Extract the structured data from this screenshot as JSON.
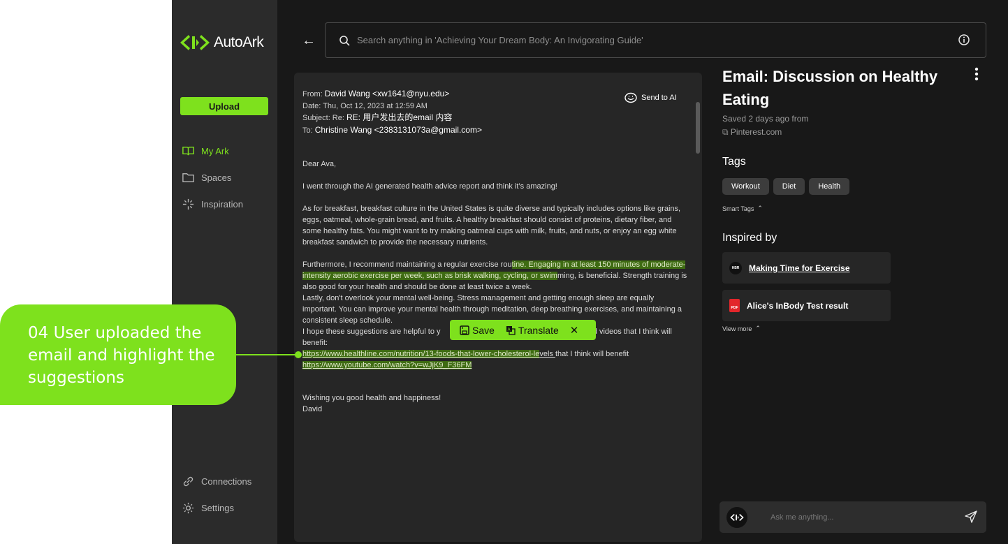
{
  "brand": {
    "name": "AutoArk",
    "accent": "#7ee11d"
  },
  "sidebar": {
    "upload_label": "Upload",
    "nav": [
      {
        "label": "My Ark",
        "icon": "book-icon",
        "active": true
      },
      {
        "label": "Spaces",
        "icon": "folder-icon",
        "active": false
      },
      {
        "label": "Inspiration",
        "icon": "sparkle-icon",
        "active": false
      }
    ],
    "bottom_nav": [
      {
        "label": "Connections",
        "icon": "link-icon"
      },
      {
        "label": "Settings",
        "icon": "gear-icon"
      }
    ]
  },
  "search": {
    "placeholder": "Search anything in 'Achieving Your Dream Body: An Invigorating Guide'"
  },
  "email": {
    "from_label": "From:",
    "from_value": "David Wang <xw1641@nyu.edu>",
    "date_line": "Date: Thu, Oct 12, 2023 at 12:59 AM",
    "subject_label": "Subject: Re:",
    "subject_value": "RE: 用户发出去的email 内容",
    "to_label": "To:",
    "to_value": "Christine Wang <2383131073a@gmail.com>",
    "send_to_ai": "Send to AI",
    "greeting": "Dear Ava,",
    "p1": " I went through the AI generated health advice report and think it’s amazing!",
    "p2": "As for breakfast, breakfast culture in the United States is quite diverse and typically includes options like grains, eggs, oatmeal, whole-grain bread, and fruits. A healthy breakfast should consist of proteins, dietary fiber, and some healthy fats. You might want to try making oatmeal cups with milk, fruits, and nuts, or enjoy an egg white breakfast sandwich to provide the necessary nutrients.",
    "p3_a": "Furthermore, I recommend maintaining a regular exercise rou",
    "p3_hl": "tine. Engaging in at least 150 minutes of moderate-intensity aerobic exercise per week, such as brisk walking, cycling, or swim",
    "p3_b": "ming, is beneficial. Strength training is also good for your health and should be done at least twice a week.",
    "p4": "Lastly, don't overlook your mental well-being. Stress management and getting enough sleep are equally important. You can improve your mental health through meditation, deep breathing exercises, and maintaining a consistent sleep schedule.",
    "p5_a": "I hope these suggestions are helpful to y",
    "p5_b": "and videos that I think will benefit:",
    "link1_hl": "https://www.healthline.com/nutrition/13-foods-that-lower-cholesterol-le",
    "link1_rest": "vels ",
    "link1_tail": "that I think will benefit",
    "link2": "https://www.youtube.com/watch?v=wJjK9_F36FM",
    "closing": "Wishing you good health and happiness!",
    "signature": "David"
  },
  "float_bar": {
    "save": "Save",
    "translate": "Translate"
  },
  "detail": {
    "title": "Email: Discussion on Healthy Eating",
    "saved": "Saved 2 days ago from",
    "source": "Pinterest.com",
    "tags_heading": "Tags",
    "tags": [
      "Workout",
      "Diet",
      "Health"
    ],
    "smart_tags": "Smart Tags",
    "inspired_heading": "Inspired by",
    "inspired": [
      {
        "title": "Making Time for Exercise",
        "badge": "HBR"
      },
      {
        "title": "Alice's InBody Test result",
        "badge": "PDF"
      }
    ],
    "view_more": "View more"
  },
  "ask": {
    "placeholder": "Ask me anything..."
  },
  "annotation": {
    "text": "04 User uploaded the email and highlight the suggestions"
  }
}
